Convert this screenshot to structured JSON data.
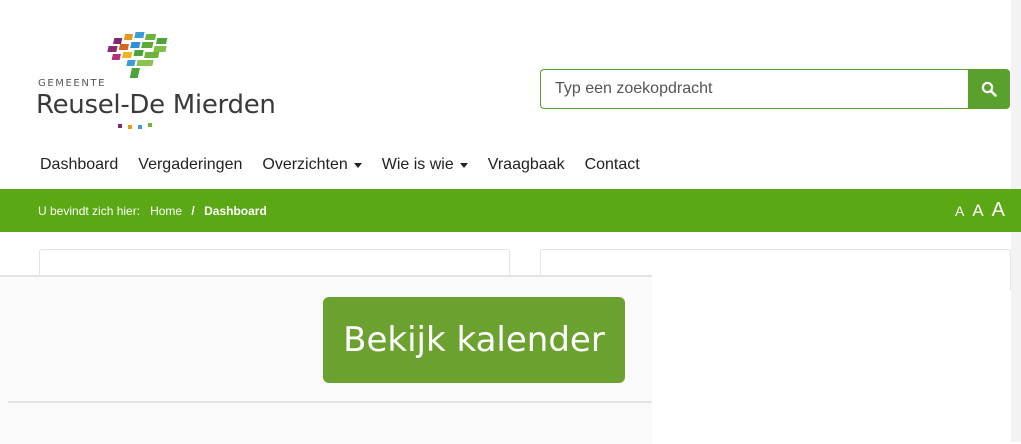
{
  "header": {
    "logo_small": "GEMEENTE",
    "logo_name": "Reusel-De Mierden"
  },
  "search": {
    "placeholder": "Typ een zoekopdracht",
    "button_icon": "search-icon"
  },
  "nav": {
    "items": [
      {
        "label": "Dashboard",
        "dropdown": false
      },
      {
        "label": "Vergaderingen",
        "dropdown": false
      },
      {
        "label": "Overzichten",
        "dropdown": true
      },
      {
        "label": "Wie is wie",
        "dropdown": true
      },
      {
        "label": "Vraagbaak",
        "dropdown": false
      },
      {
        "label": "Contact",
        "dropdown": false
      }
    ]
  },
  "breadcrumb": {
    "prefix": "U bevindt zich hier:",
    "home": "Home",
    "separator": "/",
    "current": "Dashboard"
  },
  "font_size": {
    "small": "A",
    "medium": "A",
    "large": "A"
  },
  "calendar": {
    "button_label": "Bekijk kalender"
  },
  "colors": {
    "brand_green": "#5aa814",
    "button_green": "#6aa12f"
  }
}
